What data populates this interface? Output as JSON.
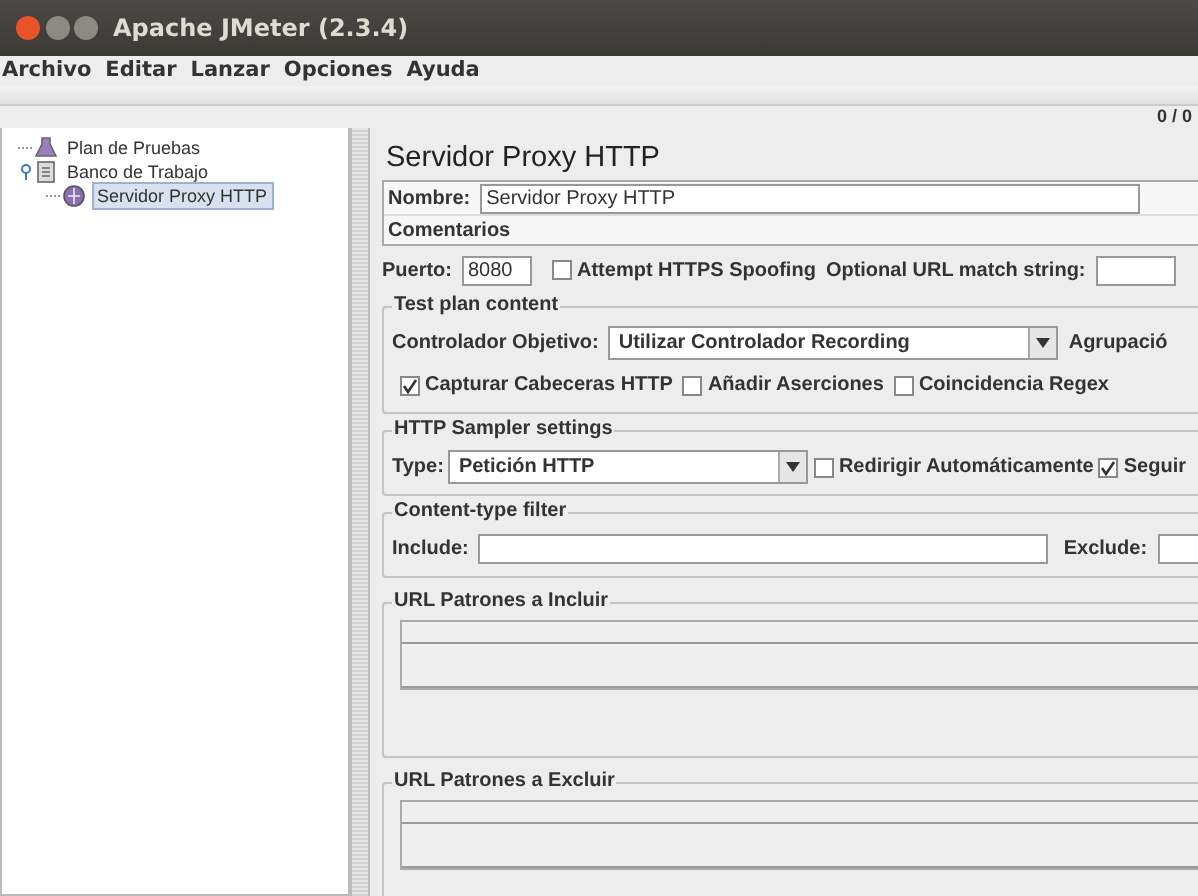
{
  "window": {
    "title": "Apache JMeter (2.3.4)"
  },
  "menu": [
    {
      "label": "Archivo"
    },
    {
      "label": "Editar"
    },
    {
      "label": "Lanzar"
    },
    {
      "label": "Opciones"
    },
    {
      "label": "Ayuda"
    }
  ],
  "toolbar": {
    "counter": "0 / 0"
  },
  "tree": [
    {
      "label": "Plan de Pruebas",
      "kind": "plan",
      "selected": false
    },
    {
      "label": "Banco de Trabajo",
      "kind": "workbench",
      "selected": false,
      "expanded": true,
      "children": [
        {
          "label": "Servidor Proxy HTTP",
          "kind": "proxy",
          "selected": true
        }
      ]
    }
  ],
  "panel": {
    "title": "Servidor Proxy HTTP",
    "name_label": "Nombre:",
    "name_value": "Servidor Proxy HTTP",
    "comments_label": "Comentarios",
    "port_label": "Puerto:",
    "port_value": "8080",
    "https_spoofing": {
      "label": "Attempt HTTPS Spoofing",
      "checked": false
    },
    "url_match_label": "Optional URL match string:",
    "test_plan": {
      "legend": "Test plan content",
      "target_label": "Controlador Objetivo:",
      "target_value": "Utilizar Controlador Recording",
      "grouping_label": "Agrupació",
      "options": [
        {
          "label": "Capturar Cabeceras HTTP",
          "checked": true
        },
        {
          "label": "Añadir Aserciones",
          "checked": false
        },
        {
          "label": "Coincidencia Regex",
          "checked": false
        }
      ]
    },
    "sampler": {
      "legend": "HTTP Sampler settings",
      "type_label": "Type:",
      "type_value": "Petición HTTP",
      "options": [
        {
          "label": "Redirigir Automáticamente",
          "checked": false
        },
        {
          "label": "Seguir",
          "checked": true
        }
      ]
    },
    "content_filter": {
      "legend": "Content-type filter",
      "include_label": "Include:",
      "exclude_label": "Exclude:"
    },
    "include_patterns": {
      "legend": "URL Patrones a Incluir"
    },
    "exclude_patterns": {
      "legend": "URL Patrones a Excluir"
    }
  }
}
